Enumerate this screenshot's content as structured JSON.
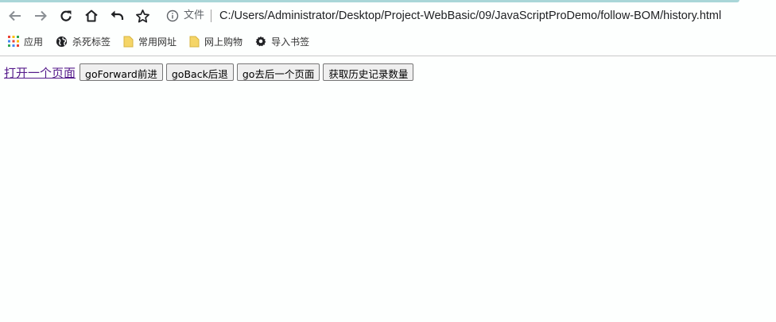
{
  "browser": {
    "address_chip": "文件",
    "url": "C:/Users/Administrator/Desktop/Project-WebBasic/09/JavaScriptProDemo/follow-BOM/history.html",
    "bookmarks": [
      {
        "label": "应用",
        "icon": "apps-grid-icon"
      },
      {
        "label": "杀死标签",
        "icon": "globe-icon"
      },
      {
        "label": "常用网址",
        "icon": "folder-icon"
      },
      {
        "label": "网上购物",
        "icon": "folder-icon"
      },
      {
        "label": "导入书签",
        "icon": "gear-icon"
      }
    ],
    "colors": {
      "tab_accent": "#a9d6d8",
      "folder": "#f5d567",
      "link_visited": "#551a8b"
    }
  },
  "page": {
    "link_label": "打开一个页面",
    "buttons": {
      "forward": "goForward前进",
      "back": "goBack后退",
      "go": "go去后一个页面",
      "count": "获取历史记录数量"
    }
  }
}
